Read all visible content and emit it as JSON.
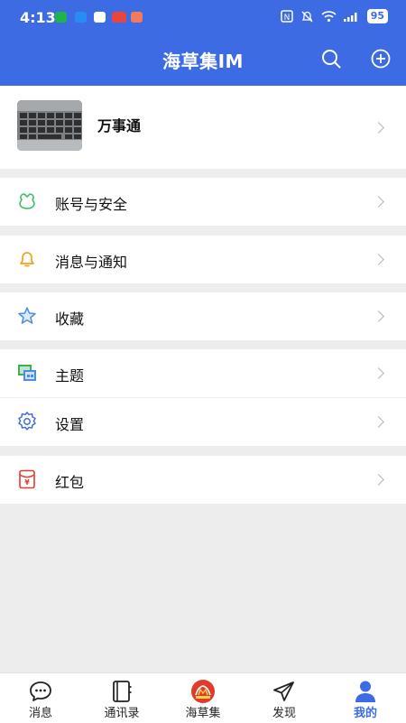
{
  "status_bar": {
    "time": "4:13",
    "battery": "95",
    "notification_colors": [
      "#1fb34a",
      "#2a8bf2",
      "#1f7cf0",
      "#e8453c",
      "#f07a5a"
    ]
  },
  "header": {
    "title": "海草集IM",
    "search_icon": "search-icon",
    "add_icon": "plus-circle-icon"
  },
  "profile": {
    "name": "万事通"
  },
  "menu": [
    {
      "label": "账号与安全",
      "icon": "shield-icon",
      "color": "#3fbf6e"
    },
    {
      "label": "消息与通知",
      "icon": "bell-icon",
      "color": "#f2a21b"
    },
    {
      "label": "收藏",
      "icon": "star-icon",
      "color": "#4b8de0"
    },
    {
      "label": "主题",
      "icon": "theme-icon",
      "color": "#3fae5a"
    },
    {
      "label": "设置",
      "icon": "gear-icon",
      "color": "#3d6be3"
    },
    {
      "label": "红包",
      "icon": "red-packet-icon",
      "color": "#e23b2e"
    }
  ],
  "tabs": [
    {
      "label": "消息",
      "icon": "chat-bubble-icon"
    },
    {
      "label": "通讯录",
      "icon": "contacts-book-icon"
    },
    {
      "label": "海草集",
      "icon": "app-logo-icon"
    },
    {
      "label": "发现",
      "icon": "paper-plane-icon"
    },
    {
      "label": "我的",
      "icon": "person-icon",
      "active": true
    }
  ],
  "colors": {
    "primary": "#3d6be3",
    "background": "#ededed"
  }
}
